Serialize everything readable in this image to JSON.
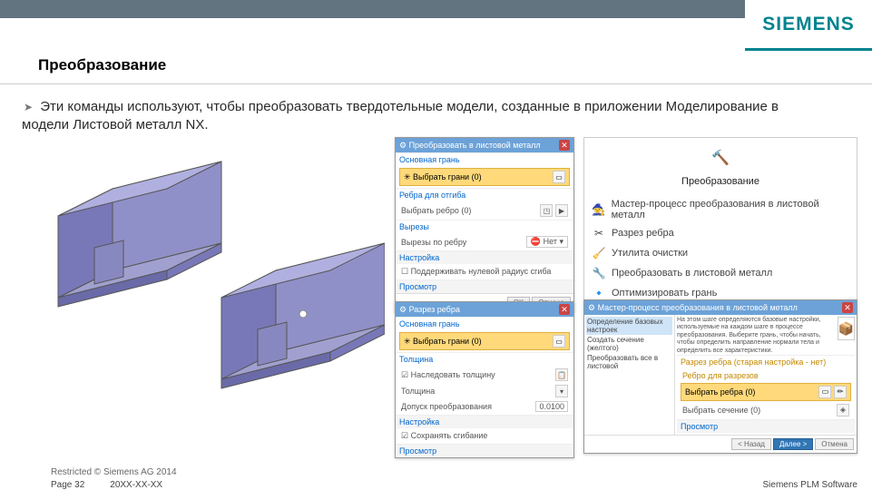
{
  "header": {
    "logo": "SIEMENS",
    "title": "Преобразование"
  },
  "body": {
    "text": "Эти команды используют, чтобы преобразовать твердотельные модели, созданные в приложении Моделирование в модели Листовой металл NX."
  },
  "dialog1": {
    "title": "Преобразовать в листовой металл",
    "sec1": "Основная грань",
    "field1": "Выбрать грани (0)",
    "sec2": "Ребра для отгиба",
    "row1": "Выбрать ребро (0)",
    "sec3": "Вырезы",
    "row2": "Вырезы по ребру",
    "row2v": "Нет",
    "sec4": "Настройка",
    "row3": "Поддерживать нулевой радиус сгиба",
    "sec5": "Просмотр",
    "ok": "OK",
    "cancel": "Отмена"
  },
  "dialog2": {
    "title": "Разрез ребра",
    "sec1": "Основная грань",
    "field1": "Выбрать грани (0)",
    "sec2": "Толщина",
    "row1": "Наследовать толщину",
    "row2": "Толщина",
    "row3": "Допуск преобразования",
    "row3v": "0.0100",
    "sec3": "Настройка",
    "row4": "Сохранять сгибание",
    "sec4": "Просмотр"
  },
  "menu": {
    "title": "Преобразование",
    "items": [
      "Мастер-процесс преобразования в листовой металл",
      "Разрез ребра",
      "Утилита очистки",
      "Преобразовать в листовой металл",
      "Оптимизировать грань"
    ]
  },
  "dialog3": {
    "title": "Мастер-процесс преобразования в листовой металл",
    "nav1": "Определение базовых настроек",
    "nav2": "Создать сечение (желтого)",
    "nav3": "Преобразовать все в листовой",
    "desc": "На этом шаге определяются базовые настройки, используемые на каждом шаге в процессе преобразования. Выберите грань, чтобы начать, чтобы определить направление нормали тела и определить все характеристики.",
    "sec1": "Разрез ребра (старая настройка - нет)",
    "row1": "Ребро для разрезов",
    "field1": "Выбрать ребра (0)",
    "row2": "Выбрать сечение (0)",
    "sec2": "Просмотр",
    "back": "< Назад",
    "next": "Далее >",
    "cancel": "Отмена"
  },
  "footer": {
    "restricted": "Restricted © Siemens AG 2014",
    "page": "Page 32",
    "date": "20XX-XX-XX",
    "plm": "Siemens PLM Software"
  }
}
